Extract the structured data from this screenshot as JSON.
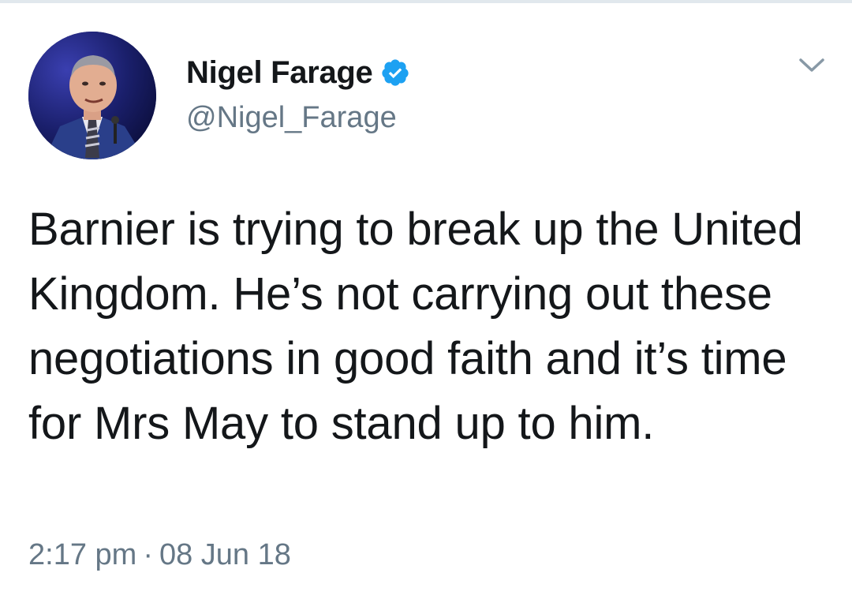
{
  "tweet": {
    "author": {
      "display_name": "Nigel Farage",
      "handle": "@Nigel_Farage",
      "verified": true
    },
    "text": "Barnier is trying to break up the United Kingdom. He’s not carrying out these negotiations in good faith and it’s time for Mrs May to stand up to him.",
    "time": "2:17 pm",
    "separator": "·",
    "date": "08 Jun 18"
  },
  "colors": {
    "text": "#14171a",
    "secondary": "#657786",
    "verified_blue": "#1da1f2",
    "rule": "#e1e8ed"
  },
  "icons": {
    "verified": "verified-badge-icon",
    "menu": "chevron-down-icon"
  }
}
